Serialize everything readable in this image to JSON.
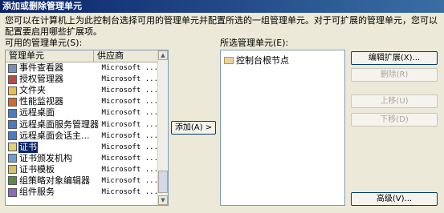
{
  "window": {
    "title": "添加或删除管理单元"
  },
  "description": "您可以在计算机上为此控制台选择可用的管理单元并配置所选的一组管理单元。对于可扩展的管理单元，您可以配置要启用哪些扩展项。",
  "available": {
    "label": "可用的管理单元(S):",
    "columns": {
      "name": "管理单元",
      "vendor": "供应商"
    },
    "items": [
      {
        "name": "事件查看器",
        "vendor": "Microsoft ...",
        "icon": "event-viewer-icon",
        "color": "#7a8fb8"
      },
      {
        "name": "授权管理器",
        "vendor": "Microsoft ...",
        "icon": "authorization-manager-icon",
        "color": "#b84a4a"
      },
      {
        "name": "文件夹",
        "vendor": "Microsoft ...",
        "icon": "folder-icon",
        "color": "#e8c04a"
      },
      {
        "name": "性能监视器",
        "vendor": "Microsoft ...",
        "icon": "performance-monitor-icon",
        "color": "#d46a2a"
      },
      {
        "name": "远程桌面",
        "vendor": "Microsoft ...",
        "icon": "remote-desktop-icon",
        "color": "#4a7ac0"
      },
      {
        "name": "远程桌面服务管理器",
        "vendor": "Microsoft ...",
        "icon": "rds-manager-icon",
        "color": "#4a7ac0"
      },
      {
        "name": "远程桌面会话主...",
        "vendor": "Microsoft ...",
        "icon": "rd-session-host-icon",
        "color": "#4a7ac0"
      },
      {
        "name": "证书",
        "vendor": "Microsoft ...",
        "icon": "certificate-icon",
        "color": "#e0d070",
        "selected": true
      },
      {
        "name": "证书颁发机构",
        "vendor": "Microsoft ...",
        "icon": "certification-authority-icon",
        "color": "#6aa0d0"
      },
      {
        "name": "证书模板",
        "vendor": "Microsoft ...",
        "icon": "certificate-templates-icon",
        "color": "#d0c070"
      },
      {
        "name": "组策略对象编辑器",
        "vendor": "Microsoft ...",
        "icon": "gpo-editor-icon",
        "color": "#5a8a4a"
      },
      {
        "name": "组件服务",
        "vendor": "Microsoft ...",
        "icon": "component-services-icon",
        "color": "#8a6ab8"
      }
    ]
  },
  "add_button": "添加(A) >",
  "selected": {
    "label": "所选管理单元(E):",
    "root": "控制台根节点"
  },
  "buttons": {
    "edit_extensions": "编辑扩展(X)...",
    "remove": "删除(R)",
    "move_up": "上移(U)",
    "move_down": "下移(D)",
    "advanced": "高级(V)..."
  }
}
